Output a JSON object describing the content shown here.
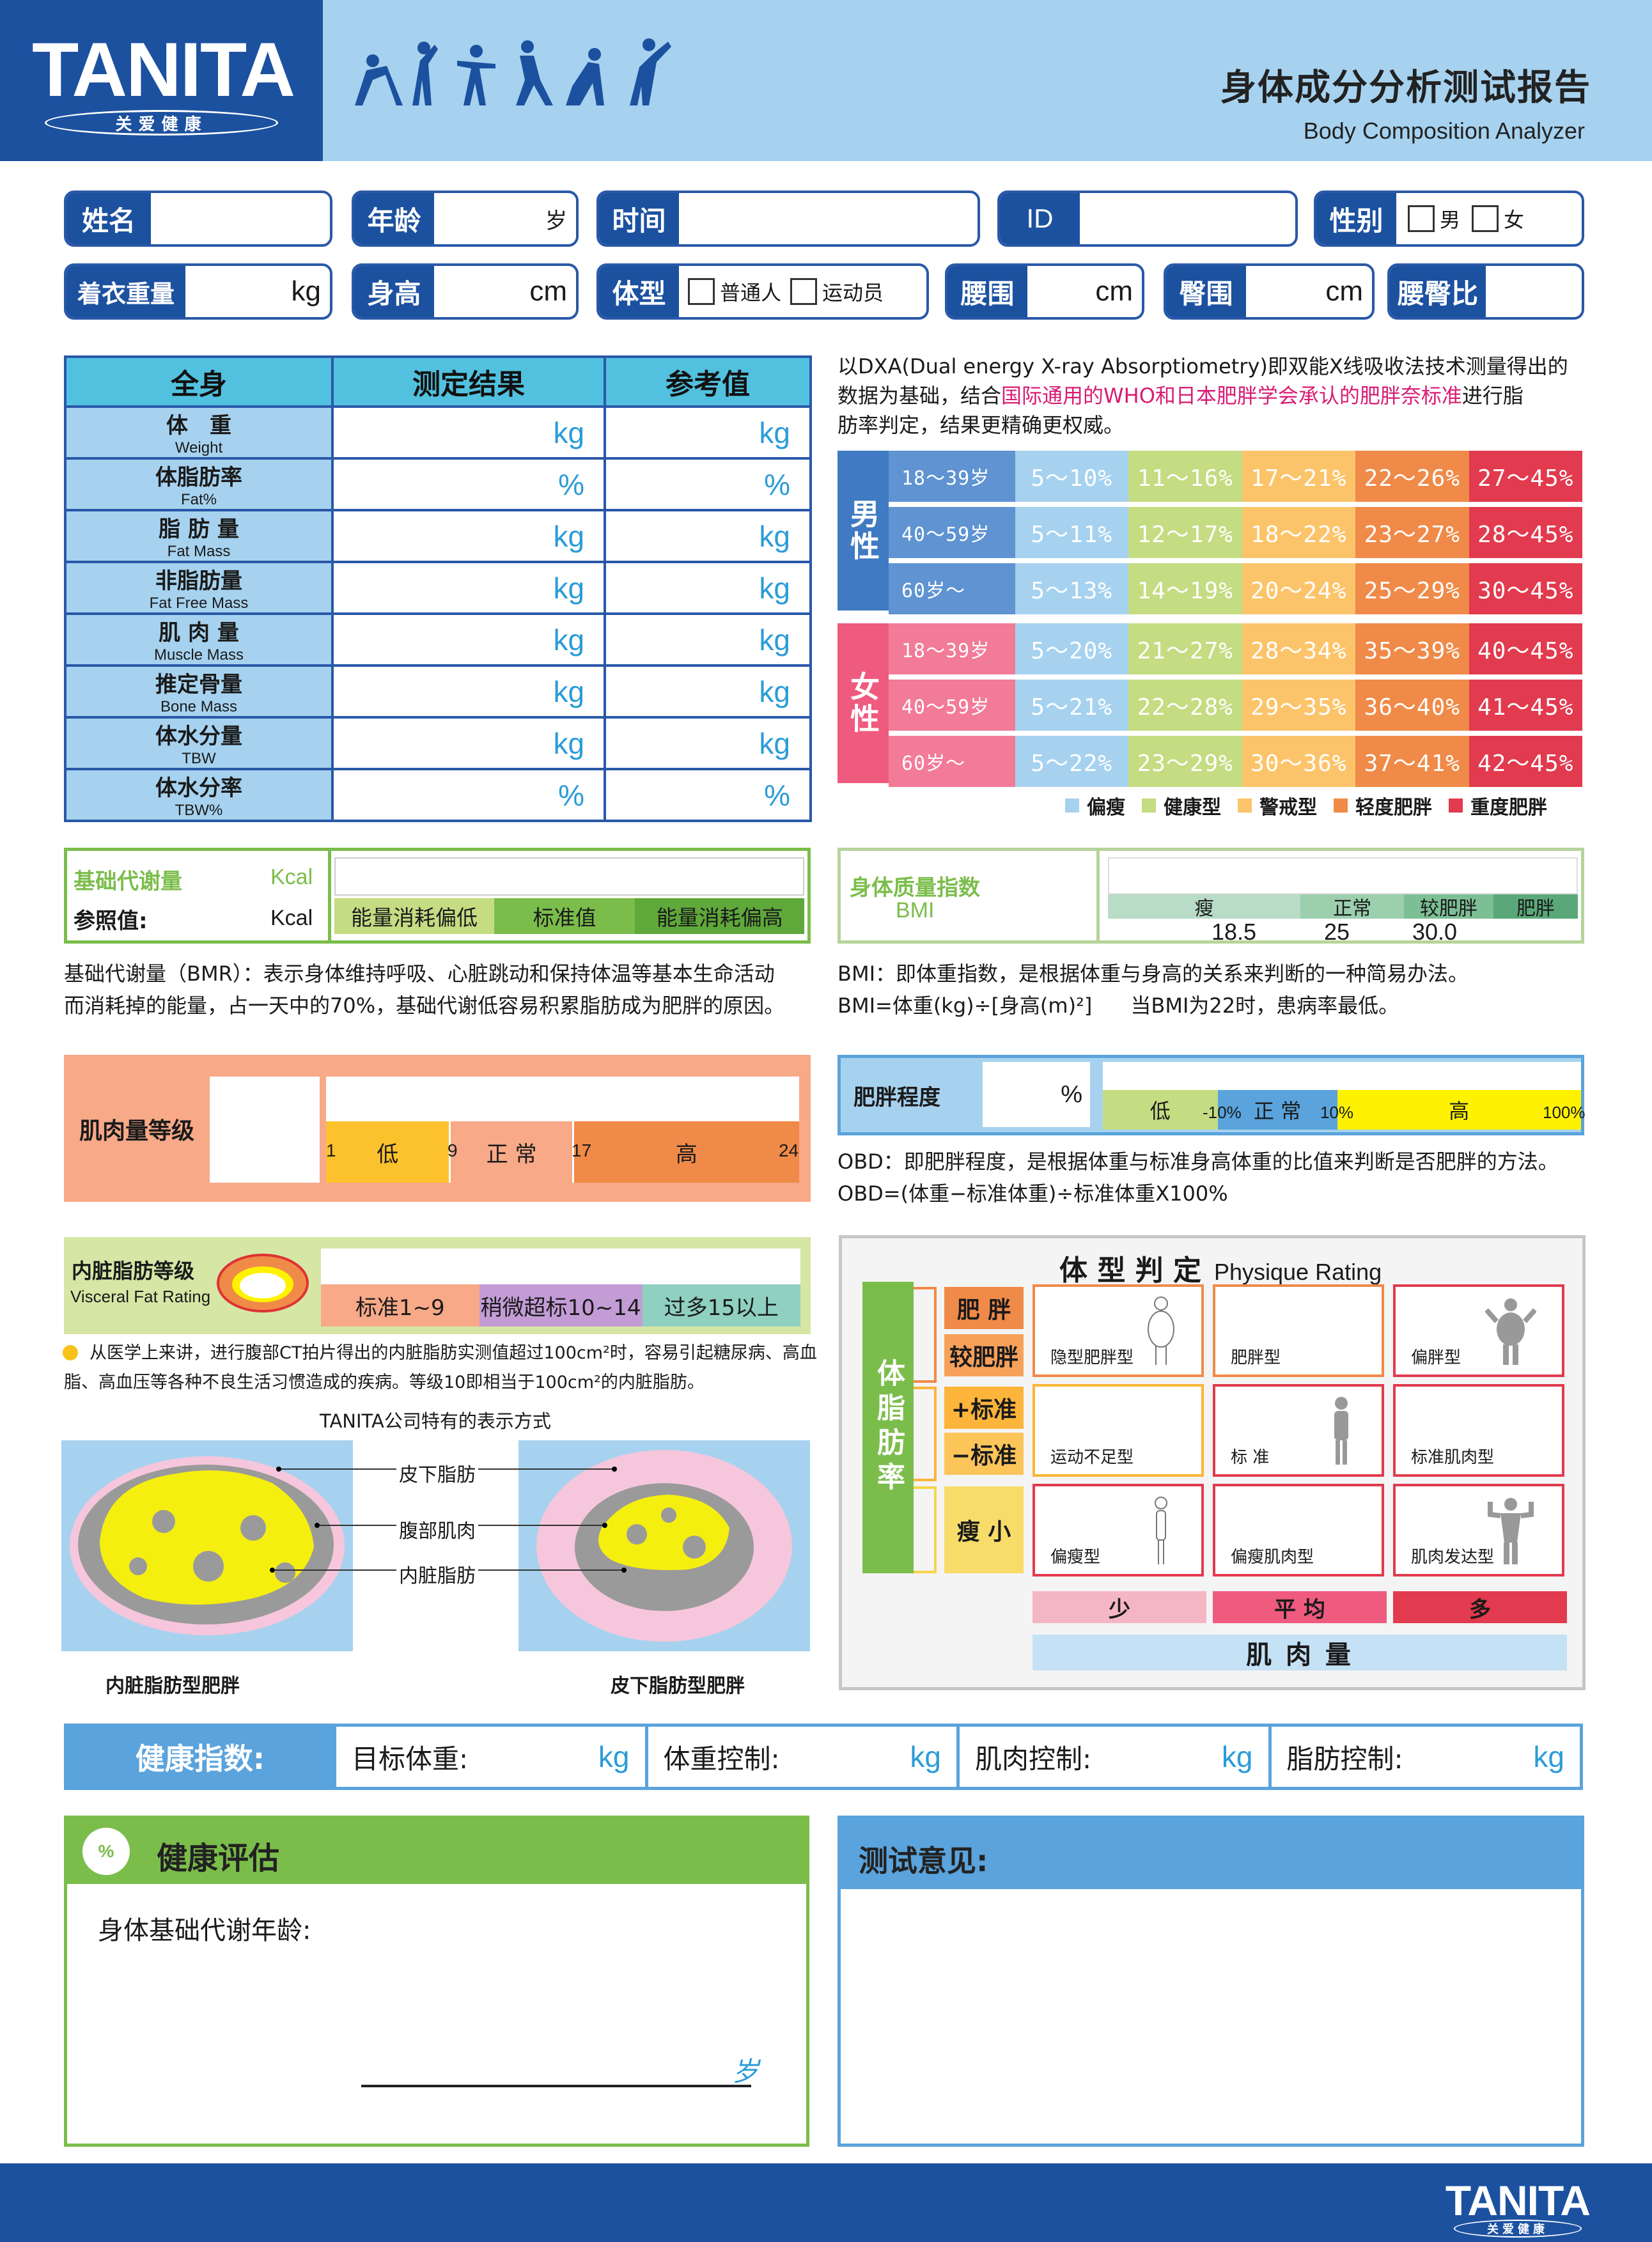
{
  "brand": {
    "logo": "TANITA",
    "tagline": "关爱健康"
  },
  "header": {
    "title_cn": "身体成分分析测试报告",
    "title_en": "Body Composition Analyzer"
  },
  "fields": {
    "name": "姓名",
    "age": "年龄",
    "age_unit": "岁",
    "time": "时间",
    "id": "ID",
    "sex": "性别",
    "male": "男",
    "female": "女",
    "clothes_weight": "着衣重量",
    "kg": "kg",
    "height": "身高",
    "cm": "cm",
    "body_type": "体型",
    "normal": "普通人",
    "athlete": "运动员",
    "waist": "腰围",
    "hip": "臀围",
    "whr": "腰臀比"
  },
  "table": {
    "headers": [
      "全身",
      "测定结果",
      "参考值"
    ],
    "rows": [
      {
        "cn": "体　重",
        "en": "Weight",
        "unit": "kg"
      },
      {
        "cn": "体脂肪率",
        "en": "Fat%",
        "unit": "%"
      },
      {
        "cn": "脂 肪 量",
        "en": "Fat Mass",
        "unit": "kg"
      },
      {
        "cn": "非脂肪量",
        "en": "Fat Free Mass",
        "unit": "kg"
      },
      {
        "cn": "肌 肉 量",
        "en": "Muscle Mass",
        "unit": "kg"
      },
      {
        "cn": "推定骨量",
        "en": "Bone Mass",
        "unit": "kg"
      },
      {
        "cn": "体水分量",
        "en": "TBW",
        "unit": "kg"
      },
      {
        "cn": "体水分率",
        "en": "TBW%",
        "unit": "%"
      }
    ]
  },
  "fat_chart": {
    "desc_1": "以DXA(Dual energy X-ray Absorptiometry)即双能X线吸收法技术测量得出的",
    "desc_2a": "数据为基础，结合",
    "desc_2b": "国际通用的WHO和日本肥胖学会承认的肥胖奈标准",
    "desc_2c": "进行脂",
    "desc_3": "肪率判定，结果更精确更权威。",
    "male": "男性",
    "female": "女性",
    "colors": [
      "#a6d2ef",
      "#d6e6a5",
      "#fcd18a",
      "#f08a48",
      "#e23a4e"
    ],
    "male_rows": [
      [
        "18～39岁",
        "5～10%",
        "11～16%",
        "17～21%",
        "22～26%",
        "27～45%"
      ],
      [
        "40～59岁",
        "5～11%",
        "12～17%",
        "18～22%",
        "23～27%",
        "28～45%"
      ],
      [
        "60岁～",
        "5～13%",
        "14～19%",
        "20～24%",
        "25～29%",
        "30～45%"
      ]
    ],
    "female_rows": [
      [
        "18～39岁",
        "5～20%",
        "21～27%",
        "28～34%",
        "35～39%",
        "40～45%"
      ],
      [
        "40～59岁",
        "5～21%",
        "22～28%",
        "29～35%",
        "36～40%",
        "41～45%"
      ],
      [
        "60岁～",
        "5～22%",
        "23～29%",
        "30～36%",
        "37～41%",
        "42～45%"
      ]
    ],
    "legend": [
      "偏瘦",
      "健康型",
      "警戒型",
      "轻度肥胖",
      "重度肥胖"
    ]
  },
  "bmr": {
    "label": "基础代谢量",
    "unit": "Kcal",
    "ref": "参照值:",
    "ref_unit": "Kcal",
    "scale": [
      "能量消耗偏低",
      "标准值",
      "能量消耗偏高"
    ],
    "note_1": "基础代谢量（BMR）：表示身体维持呼吸、心脏跳动和保持体温等基本生命活动",
    "note_2": "而消耗掉的能量，占一天中的70%，基础代谢低容易积累脂肪成为肥胖的原因。"
  },
  "bmi": {
    "label": "身体质量指数",
    "sub": "BMI",
    "scale": [
      "瘦",
      "正常",
      "较肥胖",
      "肥胖"
    ],
    "ticks": [
      "18.5",
      "25",
      "30.0"
    ],
    "note_1": "BMI：即体重指数，是根据体重与身高的关系来判断的一种简易办法。",
    "note_2": "BMI=体重(kg)÷[身高(m)²]",
    "note_3": "当BMI为22时，患病率最低。"
  },
  "muscle": {
    "label": "肌肉量等级",
    "scale": [
      "低",
      "正 常",
      "高"
    ],
    "ticks": [
      "1",
      "9",
      "17",
      "24"
    ]
  },
  "obesity": {
    "label": "肥胖程度",
    "unit": "%",
    "scale": [
      "低",
      "正 常",
      "高"
    ],
    "ticks": [
      "-10%",
      "10%",
      "100%"
    ],
    "note_1": "OBD：即肥胖程度，是根据体重与标准身高体重的比值来判断是否肥胖的方法。",
    "note_2": "OBD=(体重−标准体重)÷标准体重X100%"
  },
  "visceral": {
    "label": "内脏脂肪等级",
    "sub": "Visceral Fat Rating",
    "scale": [
      "标准1~9",
      "稍微超标10~14",
      "过多15以上"
    ],
    "note_1": "从医学上来讲，进行腹部CT拍片得出的内脏脂肪实测值超过100cm²时，容易引起糖尿病、高",
    "note_2": "血脂、高血压等各种不良生活习惯造成的疾病。等级10即相当于100cm²的内脏脂肪。",
    "ct_title": "TANITA公司特有的表示方式",
    "ct_labels": [
      "皮下脂肪",
      "腹部肌肉",
      "内脏脂肪"
    ],
    "ct_captions": [
      "内脏脂肪型肥胖",
      "皮下脂肪型肥胖"
    ]
  },
  "physique": {
    "title": "体 型 判 定",
    "title_en": "Physique Rating",
    "side": "体脂肪率",
    "rows": [
      "肥 胖",
      "较肥胖",
      "+标准",
      "−标准",
      "瘦 小"
    ],
    "cells": [
      "隐型肥胖型",
      "肥胖型",
      "偏胖型",
      "运动不足型",
      "标 准",
      "标准肌肉型",
      "偏瘦型",
      "偏瘦肌肉型",
      "肌肉发达型"
    ],
    "muscle": [
      "少",
      "平 均",
      "多"
    ],
    "muscle_label": "肌 肉 量"
  },
  "health_index": {
    "label": "健康指数:",
    "items": [
      "目标体重:",
      "体重控制:",
      "肌肉控制:",
      "脂肪控制:"
    ],
    "unit": "kg"
  },
  "evaluation": {
    "label": "健康评估",
    "icon": "%",
    "bmr_age": "身体基础代谢年龄:",
    "age_unit": "岁"
  },
  "opinion": {
    "label": "测试意见:"
  },
  "footer": {
    "logo": "TANITA",
    "tagline": "关爱健康"
  }
}
